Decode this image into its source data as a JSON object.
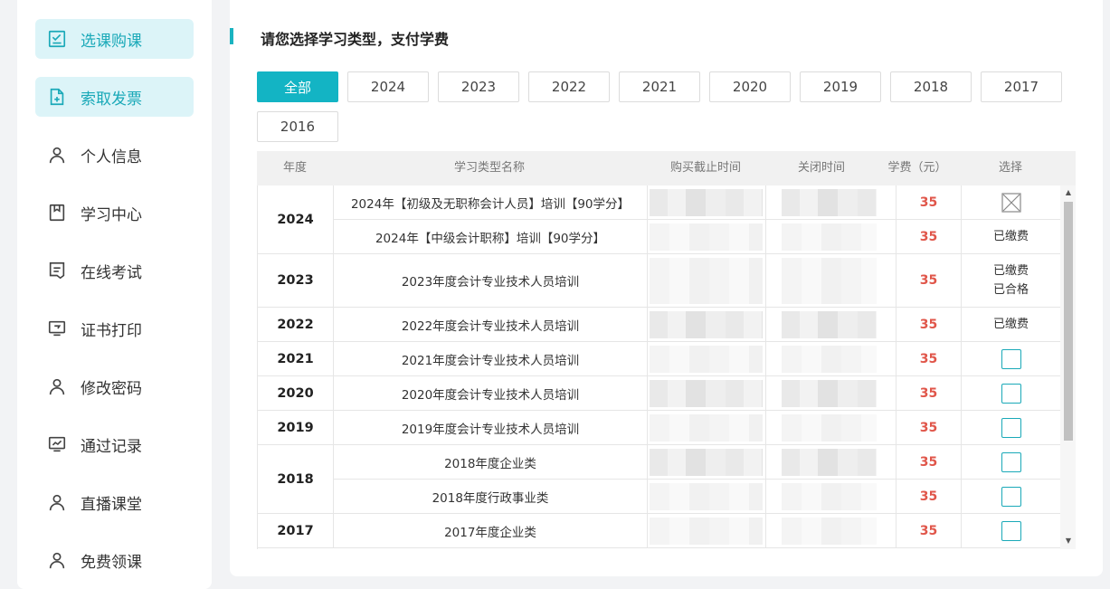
{
  "sidebar": {
    "items": [
      {
        "label": "选课购课",
        "icon": "checklist-icon",
        "active": true
      },
      {
        "label": "索取发票",
        "icon": "invoice-add-icon",
        "active": true
      },
      {
        "label": "个人信息",
        "icon": "user-icon",
        "active": false
      },
      {
        "label": "学习中心",
        "icon": "bookmark-book-icon",
        "active": false
      },
      {
        "label": "在线考试",
        "icon": "exam-icon",
        "active": false
      },
      {
        "label": "证书打印",
        "icon": "monitor-print-icon",
        "active": false
      },
      {
        "label": "修改密码",
        "icon": "user-icon",
        "active": false
      },
      {
        "label": "通过记录",
        "icon": "chart-monitor-icon",
        "active": false
      },
      {
        "label": "直播课堂",
        "icon": "user-icon",
        "active": false
      },
      {
        "label": "免费领课",
        "icon": "user-icon",
        "active": false
      }
    ]
  },
  "main": {
    "title": "请您选择学习类型，支付学费",
    "filters": [
      "全部",
      "2024",
      "2023",
      "2022",
      "2021",
      "2020",
      "2019",
      "2018",
      "2017",
      "2016"
    ],
    "active_filter": "全部"
  },
  "table": {
    "headers": [
      "年度",
      "学习类型名称",
      "购买截止时间",
      "关闭时间",
      "学费（元）",
      "选择"
    ],
    "groups": [
      {
        "year": "2024",
        "rows": [
          {
            "name": "2024年【初级及无职称会计人员】培训【90学分】",
            "fee": "35",
            "select": "disabled"
          },
          {
            "name": "2024年【中级会计职称】培训【90学分】",
            "fee": "35",
            "select": "已缴费"
          }
        ]
      },
      {
        "year": "2023",
        "rows": [
          {
            "name": "2023年度会计专业技术人员培训",
            "fee": "35",
            "select": "已缴费",
            "select2": "已合格"
          }
        ]
      },
      {
        "year": "2022",
        "rows": [
          {
            "name": "2022年度会计专业技术人员培训",
            "fee": "35",
            "select": "已缴费"
          }
        ]
      },
      {
        "year": "2021",
        "rows": [
          {
            "name": "2021年度会计专业技术人员培训",
            "fee": "35",
            "select": "checkbox"
          }
        ]
      },
      {
        "year": "2020",
        "rows": [
          {
            "name": "2020年度会计专业技术人员培训",
            "fee": "35",
            "select": "checkbox"
          }
        ]
      },
      {
        "year": "2019",
        "rows": [
          {
            "name": "2019年度会计专业技术人员培训",
            "fee": "35",
            "select": "checkbox"
          }
        ]
      },
      {
        "year": "2018",
        "rows": [
          {
            "name": "2018年度企业类",
            "fee": "35",
            "select": "checkbox"
          },
          {
            "name": "2018年度行政事业类",
            "fee": "35",
            "select": "checkbox"
          }
        ]
      },
      {
        "year": "2017",
        "rows": [
          {
            "name": "2017年度企业类",
            "fee": "35",
            "select": "checkbox"
          }
        ]
      }
    ]
  },
  "colors": {
    "accent": "#13b4c4",
    "fee": "#e0564a",
    "active_bg": "#dcf4f8"
  }
}
